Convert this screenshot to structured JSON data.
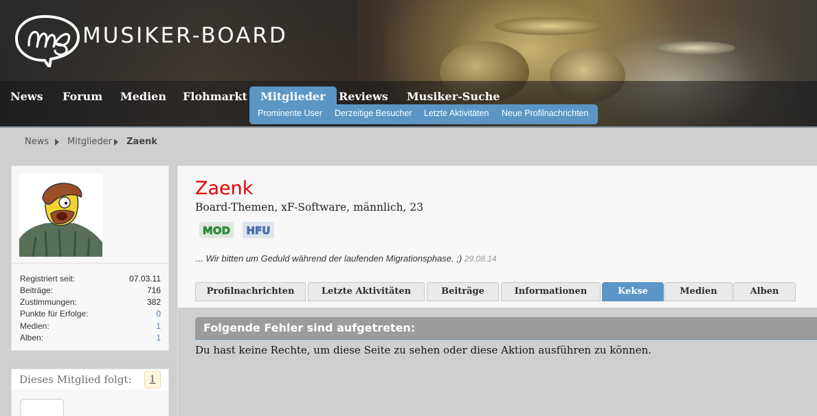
{
  "header": {
    "logo_text": "MUSIKER-BOARD",
    "logo_icon": "mb-logo-icon"
  },
  "nav": {
    "tabs": [
      {
        "label": "News",
        "active": false
      },
      {
        "label": "Forum",
        "active": false
      },
      {
        "label": "Medien",
        "active": false
      },
      {
        "label": "Flohmarkt",
        "active": false
      },
      {
        "label": "Mitglieder",
        "active": true
      },
      {
        "label": "Reviews",
        "active": false
      },
      {
        "label": "Musiker-Suche",
        "active": false
      }
    ],
    "subnav": [
      {
        "label": "Prominente User"
      },
      {
        "label": "Derzeitige Besucher"
      },
      {
        "label": "Letzte Aktivitäten"
      },
      {
        "label": "Neue Profilnachrichten"
      }
    ],
    "active_color": "#5b96c6"
  },
  "breadcrumb": {
    "items": [
      "News",
      "Mitglieder",
      "Zaenk"
    ]
  },
  "sidebar": {
    "stats": [
      {
        "label": "Registriert seit:",
        "value": "07.03.11"
      },
      {
        "label": "Beiträge:",
        "value": "716"
      },
      {
        "label": "Zustimmungen:",
        "value": "382"
      },
      {
        "label": "Punkte für Erfolge:",
        "value": "0"
      },
      {
        "label": "Medien:",
        "value": "1"
      },
      {
        "label": "Alben:",
        "value": "1"
      }
    ],
    "follow": {
      "title": "Dieses Mitglied folgt:",
      "count": "1"
    }
  },
  "profile": {
    "username": "Zaenk",
    "username_color": "#e20000",
    "user_title": "Board-Themen, xF-Software, männlich, 23",
    "badges": [
      {
        "text": "MOD",
        "color": "#2f9a3a"
      },
      {
        "text": "HFU",
        "color": "#4a78b8"
      }
    ],
    "status": "... Wir bitten um Geduld während der laufenden Migrationsphase. ;)",
    "status_date": "29.08.14",
    "tabs": [
      {
        "label": "Profilnachrichten",
        "active": false
      },
      {
        "label": "Letzte Aktivitäten",
        "active": false
      },
      {
        "label": "Beiträge",
        "active": false
      },
      {
        "label": "Informationen",
        "active": false
      },
      {
        "label": "Kekse",
        "active": true
      },
      {
        "label": "Medien",
        "active": false
      },
      {
        "label": "Alben",
        "active": false
      }
    ]
  },
  "error": {
    "title": "Folgende Fehler sind aufgetreten:",
    "message": "Du hast keine Rechte, um diese Seite zu sehen oder diese Aktion ausführen zu können."
  }
}
